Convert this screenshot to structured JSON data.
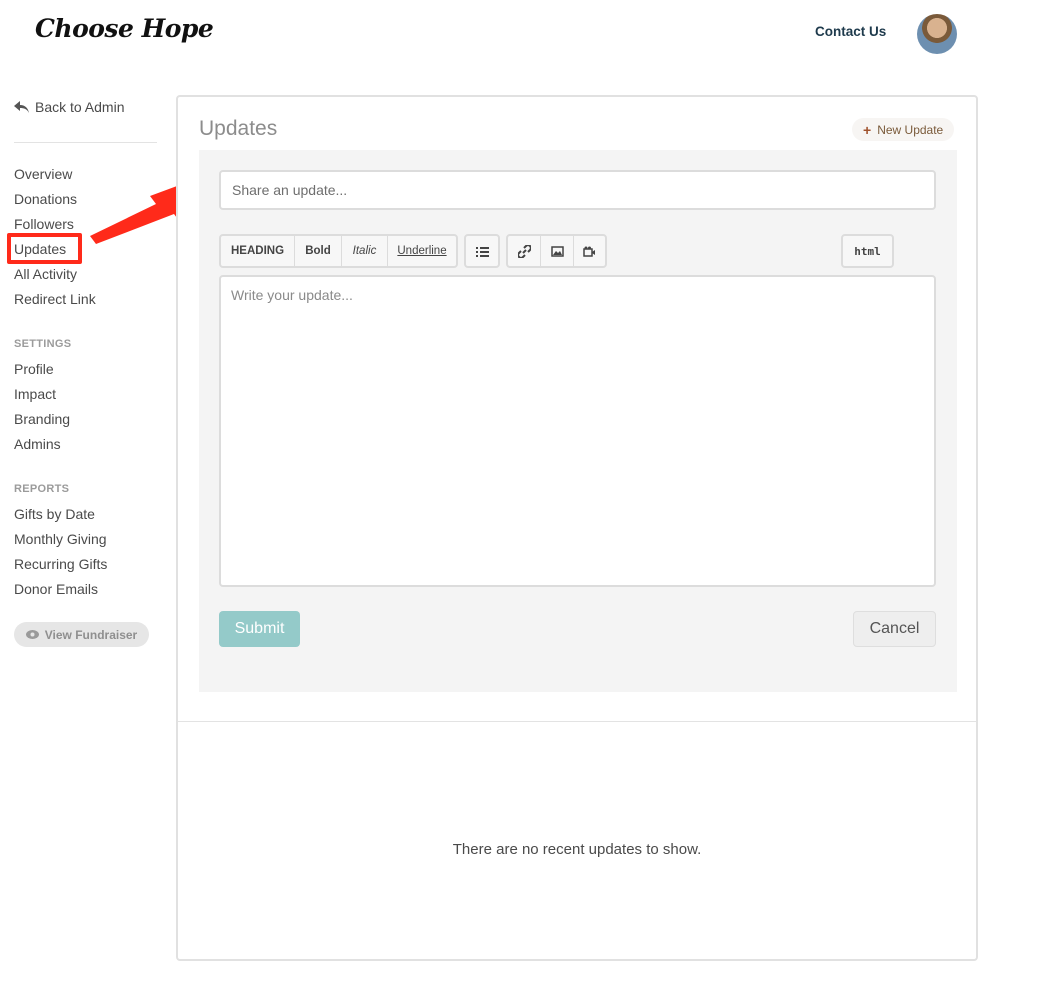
{
  "header": {
    "logo_text": "Choose Hope",
    "contact_label": "Contact Us"
  },
  "sidebar": {
    "back_label": "Back to Admin",
    "main_items": [
      {
        "label": "Overview"
      },
      {
        "label": "Donations"
      },
      {
        "label": "Followers"
      },
      {
        "label": "Updates",
        "active": true
      },
      {
        "label": "All Activity"
      },
      {
        "label": "Redirect Link"
      }
    ],
    "settings_heading": "SETTINGS",
    "settings_items": [
      {
        "label": "Profile"
      },
      {
        "label": "Impact"
      },
      {
        "label": "Branding"
      },
      {
        "label": "Admins"
      }
    ],
    "reports_heading": "REPORTS",
    "reports_items": [
      {
        "label": "Gifts by Date"
      },
      {
        "label": "Monthly Giving"
      },
      {
        "label": "Recurring Gifts"
      },
      {
        "label": "Donor Emails"
      }
    ],
    "view_fundraiser_label": "View Fundraiser"
  },
  "panel": {
    "title": "Updates",
    "new_update_label": "New Update",
    "share_placeholder": "Share an update...",
    "toolbar": {
      "heading": "HEADING",
      "bold": "Bold",
      "italic": "Italic",
      "underline": "Underline",
      "html": "html"
    },
    "write_placeholder": "Write your update...",
    "submit_label": "Submit",
    "cancel_label": "Cancel",
    "empty_message": "There are no recent updates to show."
  },
  "colors": {
    "highlight": "#ff2a1a",
    "submit_bg": "#94cac9",
    "brand_dark": "#1e3a4c"
  }
}
